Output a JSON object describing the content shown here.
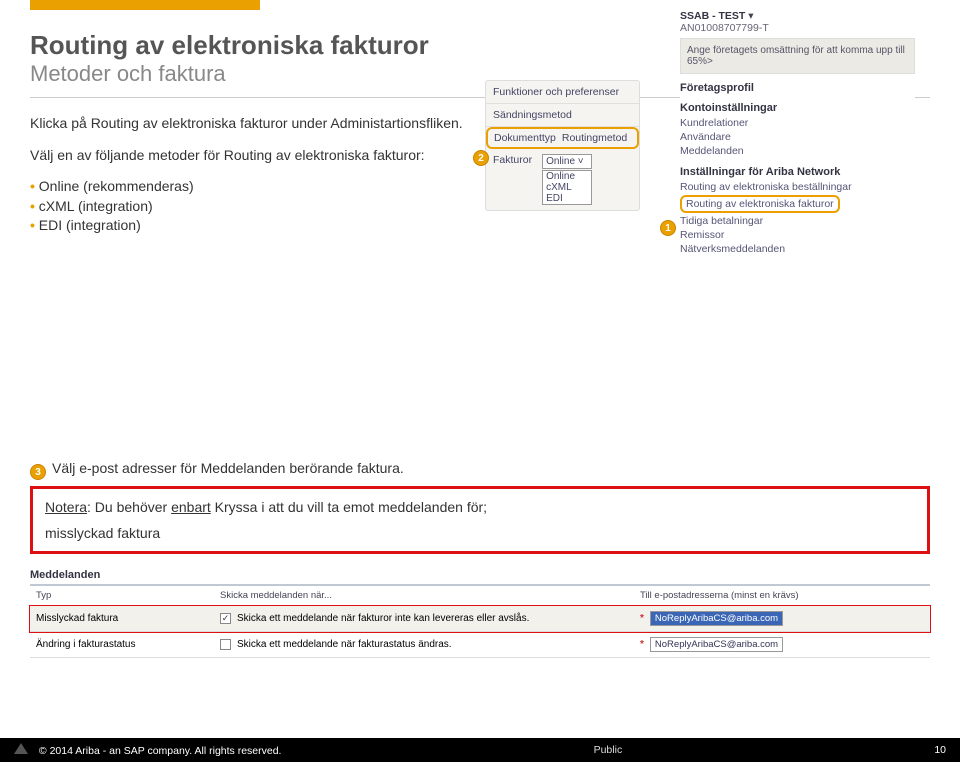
{
  "header": {
    "title": "Routing av elektroniska fakturor",
    "subtitle": "Metoder och faktura"
  },
  "intro": {
    "p1": "Klicka på Routing av elektroniska fakturor under Administartionsfliken.",
    "p2": "Välj en av följande metoder för Routing av elektroniska fakturor:",
    "bullets": [
      "Online (rekommenderas)",
      "cXML (integration)",
      "EDI (integration)"
    ]
  },
  "callouts": {
    "c1": "1",
    "c2": "2",
    "c3": "3"
  },
  "panelA": {
    "r1": "Funktioner och preferenser",
    "r2": "Sändningsmetod",
    "tab1": "Dokumenttyp",
    "tab2": "Routingmetod",
    "rowlabel": "Fakturor",
    "selected": "Online",
    "caret": "˅",
    "opts": [
      "Online",
      "cXML",
      "EDI"
    ]
  },
  "panelB": {
    "account": "SSAB - TEST",
    "caret": "▾",
    "accountId": "AN01008707799-T",
    "omsbox": "Ange företagets omsättning för att komma upp till 65%>",
    "s1": "Företagsprofil",
    "s2": "Kontoinställningar",
    "s2items": [
      "Kundrelationer",
      "Användare",
      "Meddelanden"
    ],
    "s3": "Inställningar för Ariba Network",
    "s3a": "Routing av elektroniska beställningar",
    "s3b": "Routing av elektroniska fakturor",
    "s3items": [
      "Tidiga betalningar",
      "Remissor",
      "Nätverksmeddelanden"
    ]
  },
  "lower": {
    "title": "Välj e-post adresser för Meddelanden berörande faktura.",
    "note_label": "Notera",
    "note_text1": ": Du behöver ",
    "note_enb": "enbart",
    "note_text2": " Kryssa i att du vill ta emot meddelanden för;",
    "note_line2": "misslyckad faktura"
  },
  "mtable": {
    "heading": "Meddelanden",
    "col1": "Typ",
    "col2": "Skicka meddelanden när...",
    "col3": "Till e-postadresserna (minst en krävs)",
    "rows": [
      {
        "type": "Misslyckad faktura",
        "checked": true,
        "desc": "Skicka ett meddelande när fakturor inte kan levereras eller avslås.",
        "email": "NoReplyAribaCS@ariba.com",
        "selected": true
      },
      {
        "type": "Ändring i fakturastatus",
        "checked": false,
        "desc": "Skicka ett meddelande när fakturastatus ändras.",
        "email": "NoReplyAribaCS@ariba.com",
        "selected": false
      }
    ]
  },
  "footer": {
    "copyright": "© 2014 Ariba - an SAP company. All rights reserved.",
    "classification": "Public",
    "page": "10"
  }
}
